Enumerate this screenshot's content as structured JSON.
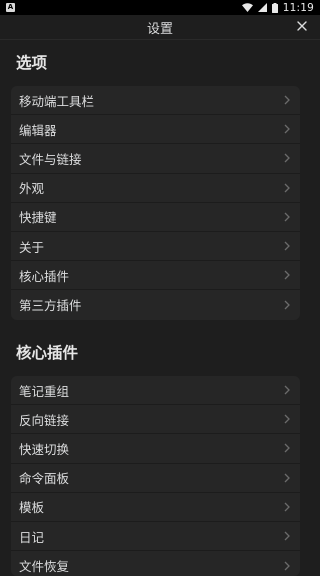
{
  "status_bar": {
    "notification_icon": "A",
    "time": "11:19",
    "icons": [
      "wifi-icon",
      "signal-icon",
      "battery-icon"
    ]
  },
  "header": {
    "title": "设置",
    "close_icon": "close-icon"
  },
  "sections": [
    {
      "title": "选项",
      "items": [
        {
          "label": "移动端工具栏"
        },
        {
          "label": "编辑器"
        },
        {
          "label": "文件与链接"
        },
        {
          "label": "外观"
        },
        {
          "label": "快捷键"
        },
        {
          "label": "关于"
        },
        {
          "label": "核心插件"
        },
        {
          "label": "第三方插件"
        }
      ]
    },
    {
      "title": "核心插件",
      "items": [
        {
          "label": "笔记重组"
        },
        {
          "label": "反向链接"
        },
        {
          "label": "快速切换"
        },
        {
          "label": "命令面板"
        },
        {
          "label": "模板"
        },
        {
          "label": "日记"
        },
        {
          "label": "文件恢复"
        }
      ]
    }
  ],
  "colors": {
    "background": "#1e1e1e",
    "group_background": "#262626",
    "text": "#dcddde",
    "chevron": "#6b6b6b"
  }
}
